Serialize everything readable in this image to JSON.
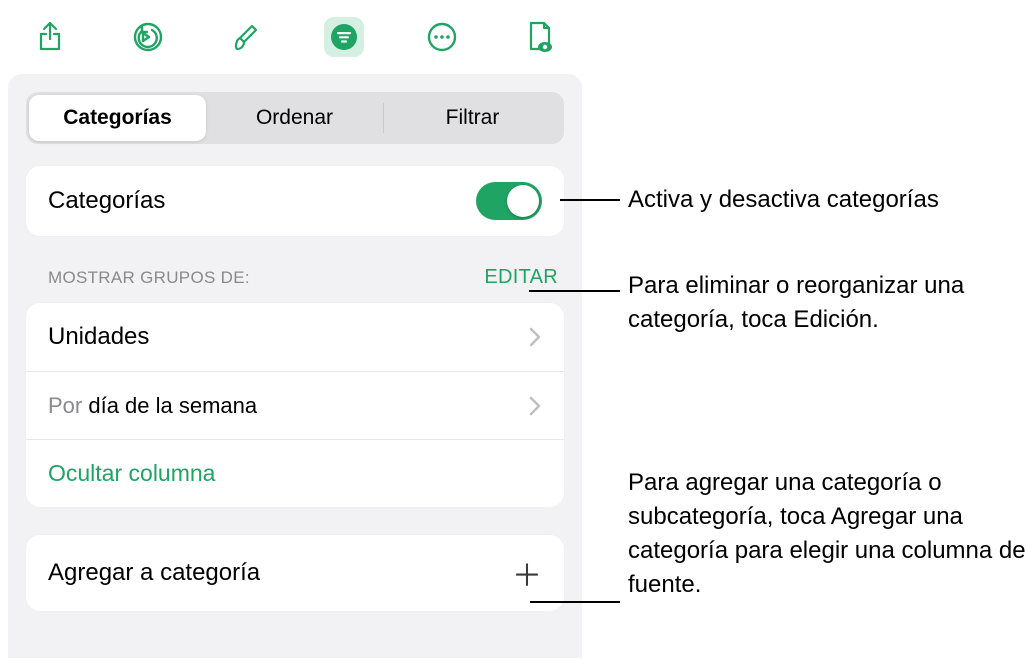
{
  "toolbar": {
    "icons": [
      "share-icon",
      "undo-icon",
      "brush-icon",
      "organize-icon",
      "more-icon",
      "document-preview-icon"
    ]
  },
  "segmented": {
    "tabs": [
      "Categorías",
      "Ordenar",
      "Filtrar"
    ],
    "active": 0
  },
  "main": {
    "categories_label": "Categorías",
    "toggle_on": true
  },
  "groups": {
    "header": "MOSTRAR GRUPOS DE:",
    "edit": "EDITAR",
    "row1": "Unidades",
    "row2_prefix": "Por ",
    "row2_rest": "día de la semana",
    "hide_column": "Ocultar columna"
  },
  "add": {
    "label": "Agregar a categoría"
  },
  "callouts": {
    "c1": "Activa y desactiva categorías",
    "c2": "Para eliminar o reorganizar una categoría, toca Edición.",
    "c3": "Para agregar una categoría o subcategoría, toca Agregar una categoría para elegir una columna de fuente."
  }
}
